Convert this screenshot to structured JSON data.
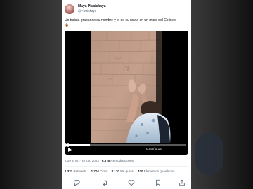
{
  "tweet": {
    "author": {
      "name": "Maya Pivaiskaya",
      "handle": "@Pivaiskaya"
    },
    "text": "Un turista grabando su nombre y el de su novia en un muro del Coliseo",
    "text_mark": "🏺",
    "video": {
      "time_readout": "0:03 / 0:16",
      "progress": 0.19
    },
    "meta": {
      "timestamp": "2:29 a. m. · 25 jun. 2023",
      "views": "6,3 M",
      "views_label": "Reproducciones"
    },
    "stats": [
      {
        "count": "1.331",
        "label": "Retweets"
      },
      {
        "count": "1.704",
        "label": "Citas"
      },
      {
        "count": "8.130",
        "label": "Me gusta"
      },
      {
        "count": "430",
        "label": "Elementos guardados"
      }
    ]
  },
  "colors": {
    "text": "#0f1419",
    "secondary": "#536471",
    "accent": "#1d9bf0"
  },
  "icons": [
    "reply-icon",
    "retweet-icon",
    "like-icon",
    "bookmark-icon",
    "share-icon",
    "play-icon",
    "volume-icon",
    "settings-icon",
    "fullscreen-icon"
  ]
}
